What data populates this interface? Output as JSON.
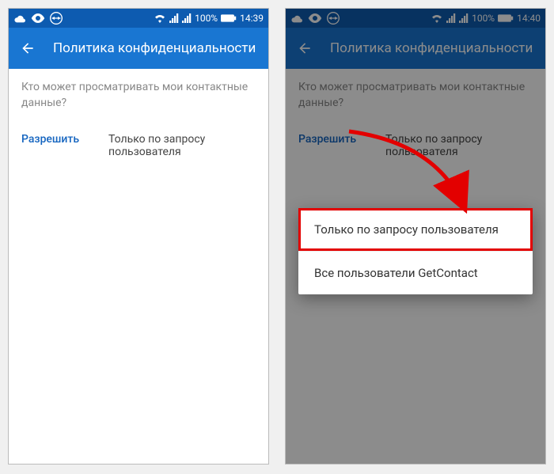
{
  "phone1": {
    "status": {
      "battery_pct": "100%",
      "time": "14:39",
      "wifi_icon": "wifi",
      "signal1_icon": "signal",
      "signal2_icon": "signal",
      "battery_icon": "battery",
      "cloud_icon": "cloud",
      "eye_icon": "eye",
      "teamviewer_icon": "teamviewer"
    },
    "appbar": {
      "title": "Политика конфиденциальности"
    },
    "section_header": "Кто может просматривать мои контактные данные?",
    "option_label": "Разрешить",
    "option_value": "Только по запросу пользователя"
  },
  "phone2": {
    "status": {
      "battery_pct": "100%",
      "time": "14:40",
      "wifi_icon": "wifi",
      "signal1_icon": "signal",
      "signal2_icon": "signal",
      "battery_icon": "battery",
      "cloud_icon": "cloud",
      "eye_icon": "eye",
      "teamviewer_icon": "teamviewer"
    },
    "appbar": {
      "title": "Политика конфиденциальности"
    },
    "section_header": "Кто может просматривать мои контактные данные?",
    "option_label": "Разрешить",
    "option_value": "Только по запросу пользователя",
    "dialog": {
      "items": [
        "Только по запросу пользователя",
        "Все пользователи GetContact"
      ]
    }
  },
  "colors": {
    "statusbar_bg": "#0d5bb0",
    "appbar_bg": "#1976d2",
    "accent_blue": "#1565c0",
    "highlight_red": "#e30000"
  }
}
